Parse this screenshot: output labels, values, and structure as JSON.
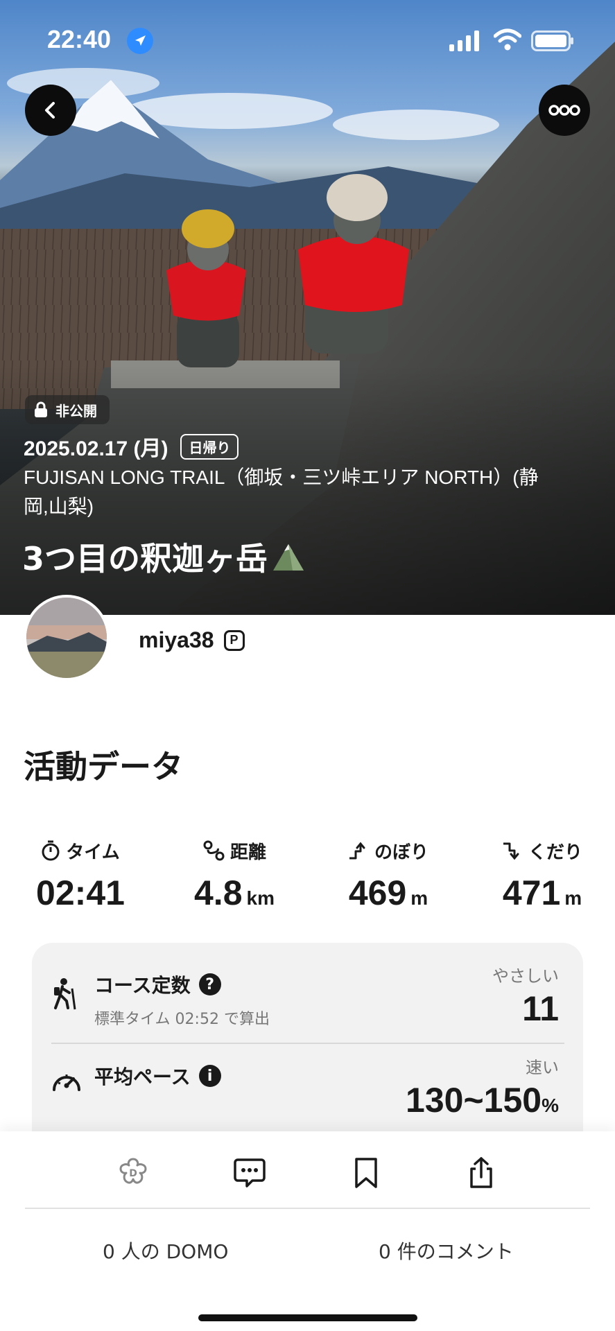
{
  "status_bar": {
    "time": "22:40"
  },
  "hero": {
    "privacy_label": "非公開",
    "date": "2025.02.17 (月)",
    "trip_type": "日帰り",
    "trail_name": "FUJISAN LONG TRAIL（御坂・三ツ峠エリア NORTH）(静岡,山梨)",
    "activity_title": "3つ目の釈迦ヶ岳"
  },
  "profile": {
    "username": "miya38",
    "badge": "P"
  },
  "activity_section": {
    "title": "活動データ"
  },
  "stats": [
    {
      "label": "タイム",
      "value": "02:41",
      "unit": "",
      "icon": "stopwatch-icon"
    },
    {
      "label": "距離",
      "value": "4.8",
      "unit": "km",
      "icon": "route-icon"
    },
    {
      "label": "のぼり",
      "value": "469",
      "unit": "m",
      "icon": "ascent-icon"
    },
    {
      "label": "くだり",
      "value": "471",
      "unit": "m",
      "icon": "descent-icon"
    }
  ],
  "course_constant": {
    "title": "コース定数",
    "subtitle": "標準タイム 02:52 で算出",
    "rating": "やさしい",
    "value": "11"
  },
  "average_pace": {
    "title": "平均ペース",
    "rating": "速い",
    "value": "130~150",
    "unit": "%"
  },
  "bottom_bar": {
    "domo_count": "0 人の DOMO",
    "comment_count": "0 件のコメント"
  },
  "colors": {
    "accent_blue": "#2f8cff",
    "text": "#1a1a1a",
    "muted": "#777777",
    "card_bg": "#f2f2f2"
  }
}
